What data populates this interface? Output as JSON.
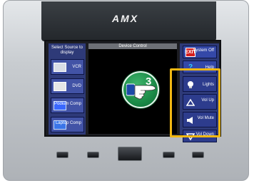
{
  "brand": "AMX",
  "left_panel": {
    "title": "Select Source to display",
    "sources": [
      {
        "label": "VCR",
        "icon": "vcr-icon"
      },
      {
        "label": "DVD",
        "icon": "dvd-icon"
      },
      {
        "label": "Podium Comp",
        "icon": "monitor-icon"
      },
      {
        "label": "Laptop Comp",
        "icon": "laptop-icon"
      }
    ]
  },
  "center_panel": {
    "title": "Device Control"
  },
  "right_panel": {
    "system_off": "System Off",
    "exit_icon": "EXIT",
    "help": "Help",
    "help_icon": "?",
    "lights": "Lights",
    "vol_up": "Vol Up",
    "vol_mute": "Vol Mute",
    "vol_down": "Vol Down"
  },
  "callout": {
    "number": "3",
    "icon": "pointing-hand-icon"
  },
  "colors": {
    "panel": "#2e3a78",
    "button": "#3448a8",
    "highlight": "#f2b812",
    "callout": "#1a8a47"
  }
}
